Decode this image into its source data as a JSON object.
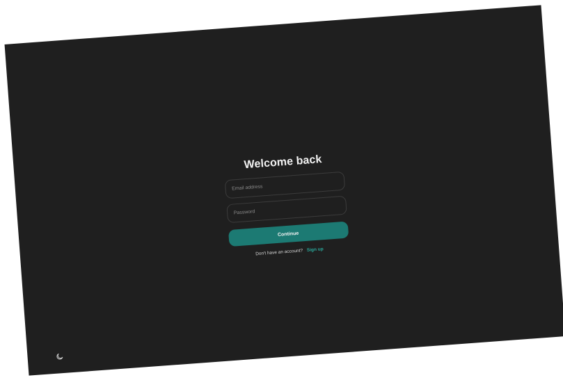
{
  "colors": {
    "background": "#1f1f1f",
    "accent": "#1c7a73",
    "link": "#2aa89b",
    "field_border": "#3c3c3c"
  },
  "login": {
    "title": "Welcome back",
    "email_placeholder": "Email address",
    "password_placeholder": "Password",
    "continue_label": "Continue",
    "signup_prompt": "Don't have an account?",
    "signup_link": "Sign up"
  },
  "footer": {
    "theme_icon": "moon-icon"
  }
}
